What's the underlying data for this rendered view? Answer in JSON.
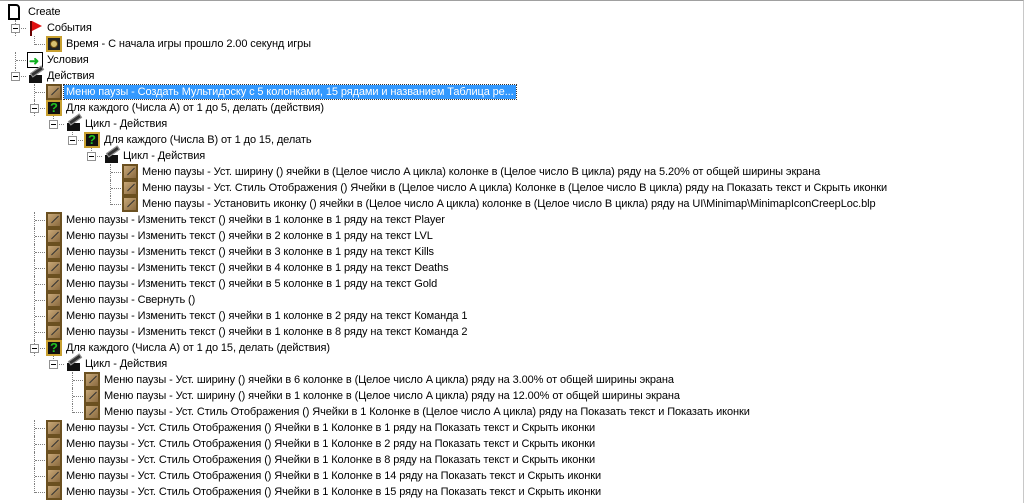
{
  "tree": [
    {
      "depth": 0,
      "icon": "page",
      "text": "Create"
    },
    {
      "depth": 1,
      "icon": "flag",
      "text": "События",
      "expanded": true
    },
    {
      "depth": 2,
      "icon": "clock",
      "text": "Время - С начала игры прошло 2.00 секунд игры"
    },
    {
      "depth": 1,
      "icon": "cond",
      "text": "Условия"
    },
    {
      "depth": 1,
      "icon": "act",
      "text": "Действия",
      "expanded": true
    },
    {
      "depth": 2,
      "icon": "pen",
      "text": "Меню паузы - Создать Мультидоску с 5 колонками, 15 рядами и названием Таблица ре...",
      "selected": true
    },
    {
      "depth": 2,
      "icon": "q",
      "text": "Для каждого (Числа A) от 1 до 5, делать (действия)",
      "expanded": true
    },
    {
      "depth": 3,
      "icon": "act",
      "text": "Цикл - Действия",
      "expanded": true
    },
    {
      "depth": 4,
      "icon": "q",
      "text": "Для каждого (Числа B) от 1 до 15, делать",
      "expanded": true
    },
    {
      "depth": 5,
      "icon": "act",
      "text": "Цикл - Действия",
      "expanded": true
    },
    {
      "depth": 6,
      "icon": "pen",
      "text": "Меню паузы - Уст. ширину () ячейки в (Целое число A цикла) колонке в (Целое число B цикла) ряду на 5.20% от общей ширины экрана"
    },
    {
      "depth": 6,
      "icon": "pen",
      "text": "Меню паузы - Уст. Стиль Отображения () Ячейки в (Целое число A цикла) Колонке в (Целое число B цикла) ряду на Показать текст и Скрыть иконки"
    },
    {
      "depth": 6,
      "icon": "pen",
      "text": "Меню паузы - Установить иконку () ячейки в (Целое число A цикла) колонке в (Целое число B цикла) ряду на UI\\Minimap\\MinimapIconCreepLoc.blp"
    },
    {
      "depth": 2,
      "icon": "pen",
      "text": "Меню паузы - Изменить текст () ячейки в 1 колонке в 1 ряду на текст Player"
    },
    {
      "depth": 2,
      "icon": "pen",
      "text": "Меню паузы - Изменить текст () ячейки в 2 колонке в 1 ряду на текст LVL"
    },
    {
      "depth": 2,
      "icon": "pen",
      "text": "Меню паузы - Изменить текст () ячейки в 3 колонке в 1 ряду на текст Kills"
    },
    {
      "depth": 2,
      "icon": "pen",
      "text": "Меню паузы - Изменить текст () ячейки в 4 колонке в 1 ряду на текст Deaths"
    },
    {
      "depth": 2,
      "icon": "pen",
      "text": "Меню паузы - Изменить текст () ячейки в 5 колонке в 1 ряду на текст Gold"
    },
    {
      "depth": 2,
      "icon": "pen",
      "text": "Меню паузы - Свернуть ()"
    },
    {
      "depth": 2,
      "icon": "pen",
      "text": "Меню паузы - Изменить текст () ячейки в 1 колонке в 2 ряду на текст Команда 1"
    },
    {
      "depth": 2,
      "icon": "pen",
      "text": "Меню паузы - Изменить текст () ячейки в 1 колонке в 8 ряду на текст Команда 2"
    },
    {
      "depth": 2,
      "icon": "q",
      "text": "Для каждого (Числа A) от 1 до 15, делать (действия)",
      "expanded": true
    },
    {
      "depth": 3,
      "icon": "act",
      "text": "Цикл - Действия",
      "expanded": true
    },
    {
      "depth": 4,
      "icon": "pen",
      "text": "Меню паузы - Уст. ширину () ячейки в 6 колонке в (Целое число A цикла) ряду на 3.00% от общей ширины экрана"
    },
    {
      "depth": 4,
      "icon": "pen",
      "text": "Меню паузы - Уст. ширину () ячейки в 1 колонке в (Целое число A цикла) ряду на 12.00% от общей ширины экрана"
    },
    {
      "depth": 4,
      "icon": "pen",
      "text": "Меню паузы - Уст. Стиль Отображения () Ячейки в 1 Колонке в (Целое число A цикла) ряду на Показать текст и Показать иконки"
    },
    {
      "depth": 2,
      "icon": "pen",
      "text": "Меню паузы - Уст. Стиль Отображения () Ячейки в 1 Колонке в 1 ряду на Показать текст и Скрыть иконки"
    },
    {
      "depth": 2,
      "icon": "pen",
      "text": "Меню паузы - Уст. Стиль Отображения () Ячейки в 1 Колонке в 2 ряду на Показать текст и Скрыть иконки"
    },
    {
      "depth": 2,
      "icon": "pen",
      "text": "Меню паузы - Уст. Стиль Отображения () Ячейки в 1 Колонке в 8 ряду на Показать текст и Скрыть иконки"
    },
    {
      "depth": 2,
      "icon": "pen",
      "text": "Меню паузы - Уст. Стиль Отображения () Ячейки в 1 Колонке в 14 ряду на Показать текст и Скрыть иконки"
    },
    {
      "depth": 2,
      "icon": "pen",
      "text": "Меню паузы - Уст. Стиль Отображения () Ячейки в 1 Колонке в 15 ряду на Показать текст и Скрыть иконки"
    }
  ]
}
